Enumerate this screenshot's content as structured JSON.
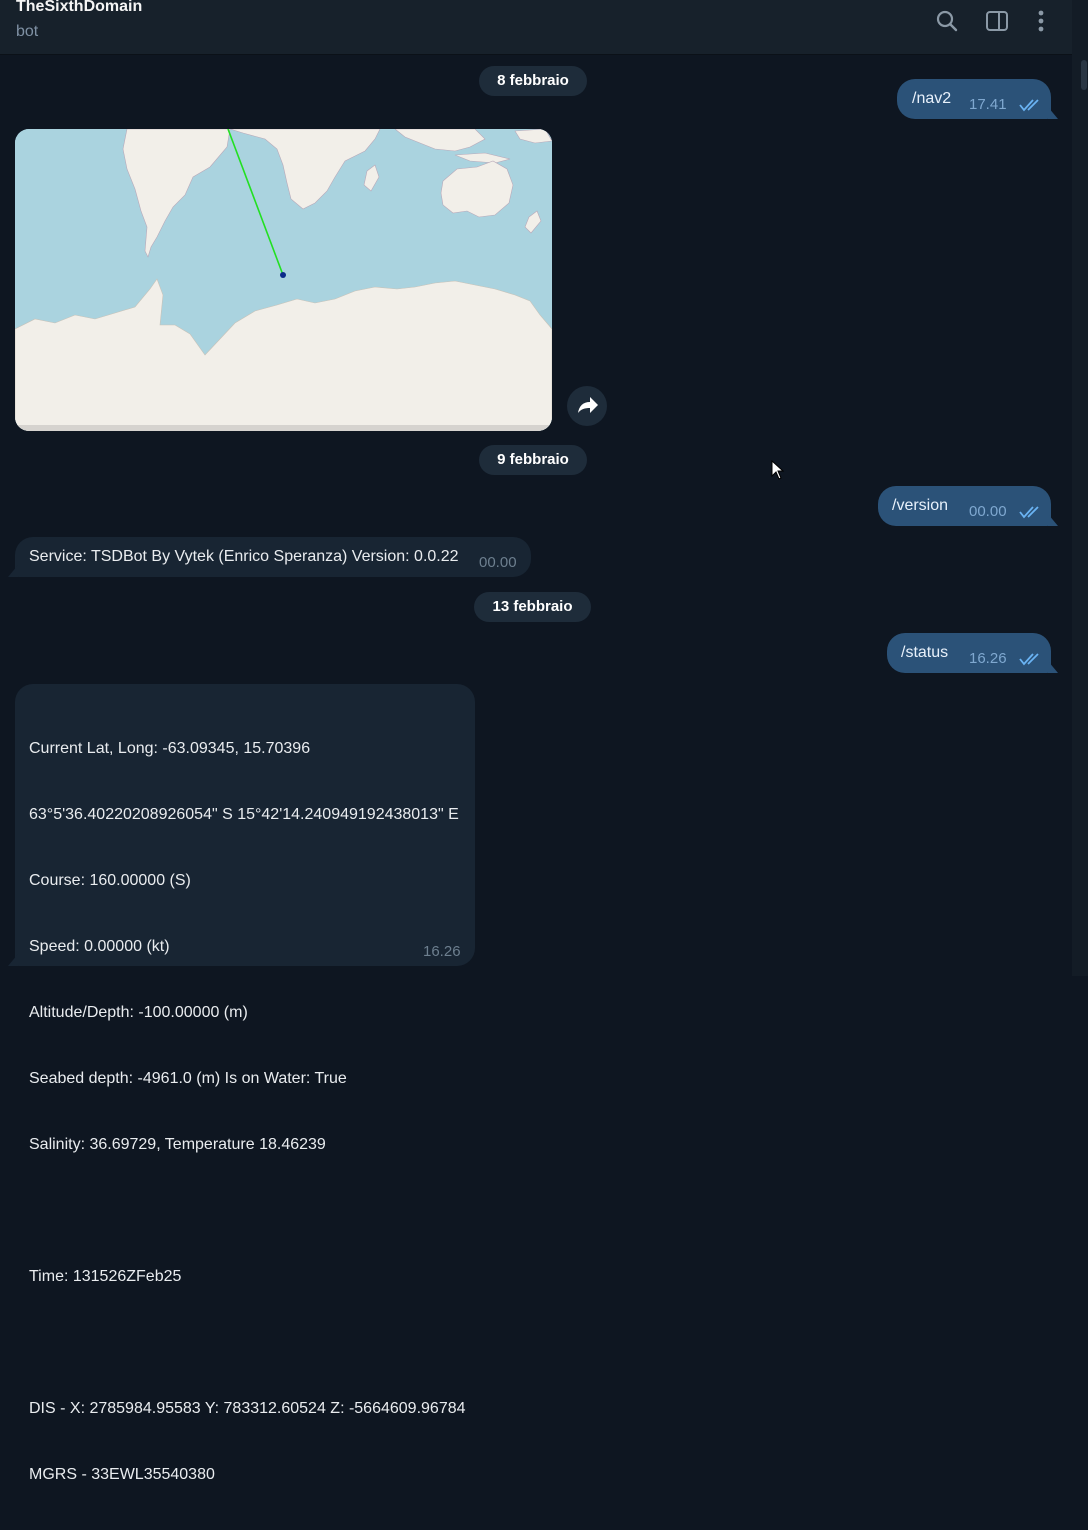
{
  "header": {
    "title": "TheSixthDomain",
    "subtitle": "bot",
    "icons": [
      "search-icon",
      "sidebar-toggle-icon",
      "more-vertical-icon"
    ]
  },
  "messages": {
    "date1": "8 febbraio",
    "nav_cmd": "/nav2",
    "nav_time": "17.41",
    "date2": "9 febbraio",
    "version_cmd": "/version",
    "version_time": "00.00",
    "version_reply": "Service: TSDBot By Vytek (Enrico Speranza) Version: 0.0.22",
    "version_reply_time": "00.00",
    "date3": "13 febbraio",
    "status_cmd": "/status",
    "status_time": "16.26",
    "status_reply": {
      "line1": "Current Lat, Long: -63.09345, 15.70396",
      "line2": "63°5'36.40220208926054\" S 15°42'14.240949192438013\" E",
      "line3": "Course: 160.00000 (S)",
      "line4": "Speed: 0.00000 (kt)",
      "line5": "Altitude/Depth: -100.00000 (m)",
      "line6": "Seabed depth: -4961.0 (m) Is on Water: True",
      "line7": "Salinity: 36.69729, Temperature 18.46239",
      "line8": "Time: 131526ZFeb25",
      "line9": "DIS - X: 2785984.95583 Y: 783312.60524 Z: -5664609.96784",
      "line10": "MGRS - 33EWL35540380",
      "time": "16.26"
    }
  },
  "colors": {
    "background": "#0e1621",
    "header": "#17212b",
    "outgoing_bubble": "#2b5278",
    "incoming_bubble": "#182533",
    "read_check": "#6ab3f3"
  }
}
